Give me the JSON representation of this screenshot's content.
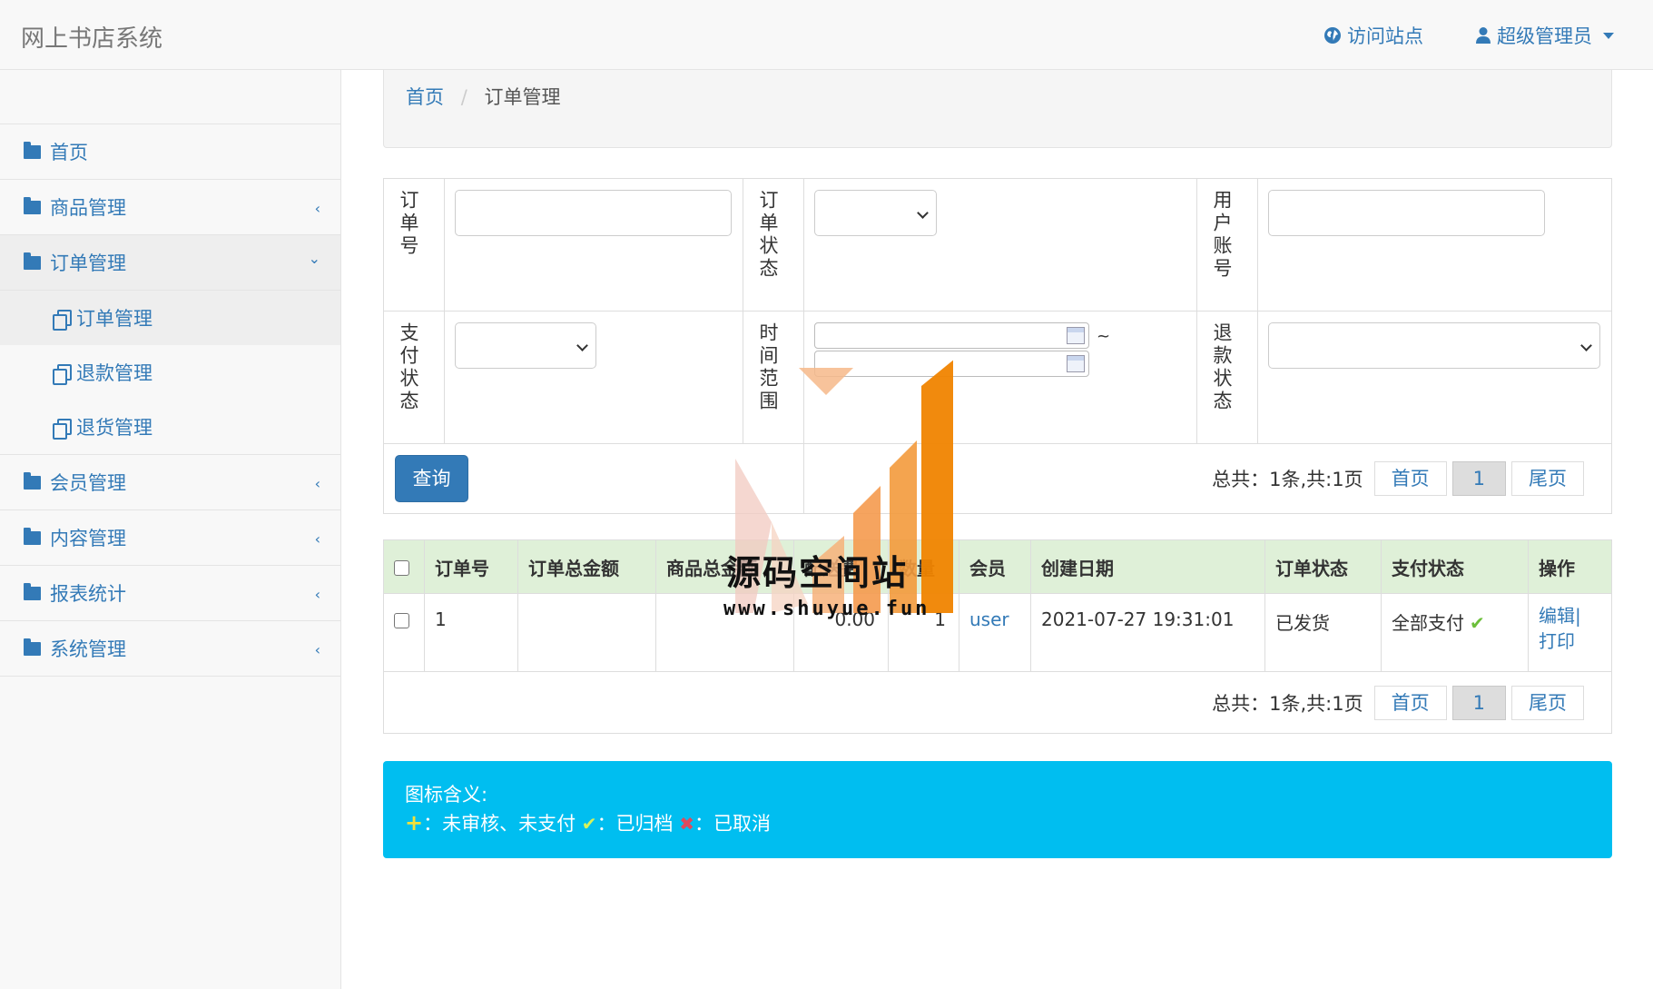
{
  "header": {
    "brand": "网上书店系统",
    "visit_site": "访问站点",
    "admin": "超级管理员"
  },
  "sidebar": {
    "items": [
      {
        "label": "首页"
      },
      {
        "label": "商品管理",
        "chevron": "‹"
      },
      {
        "label": "订单管理",
        "chevron": "⌄"
      },
      {
        "label": "会员管理",
        "chevron": "‹"
      },
      {
        "label": "内容管理",
        "chevron": "‹"
      },
      {
        "label": "报表统计",
        "chevron": "‹"
      },
      {
        "label": "系统管理",
        "chevron": "‹"
      }
    ],
    "subitems": [
      {
        "label": "订单管理"
      },
      {
        "label": "退款管理"
      },
      {
        "label": "退货管理"
      }
    ]
  },
  "breadcrumb": {
    "home": "首页",
    "separator": "/",
    "current": "订单管理"
  },
  "search": {
    "order_no_label": "订单号",
    "order_status_label": "订单状态",
    "user_account_label": "用户账号",
    "pay_status_label": "支付状态",
    "time_range_label": "时间范围",
    "refund_status_label": "退款状态",
    "tilde": "~",
    "query_button": "查询"
  },
  "pager": {
    "total": "总共：1条,共:1页",
    "first": "首页",
    "current": "1",
    "last": "尾页"
  },
  "table": {
    "headers": [
      "订单号",
      "订单总金额",
      "商品总金额",
      "配送费",
      "数量",
      "会员",
      "创建日期",
      "订单状态",
      "支付状态",
      "操作"
    ],
    "rows": [
      {
        "order_no": "1",
        "order_total": "",
        "goods_total": "",
        "shipping": "0.00",
        "quantity": "1",
        "member": "user",
        "created": "2021-07-27 19:31:01",
        "order_status": "已发货",
        "pay_status": "全部支付",
        "edit": "编辑|",
        "print": "打印"
      }
    ]
  },
  "legend": {
    "title": "图标含义:",
    "plus_text": "：未审核、未支付",
    "check_text": "：已归档",
    "cancel_text": "：已取消"
  },
  "watermark": {
    "title": "源码空间站",
    "url": "www.shuyue.fun"
  },
  "colors": {
    "primary": "#337ab7",
    "table_header_bg": "#dff0d8",
    "legend_bg": "#00bef0"
  }
}
